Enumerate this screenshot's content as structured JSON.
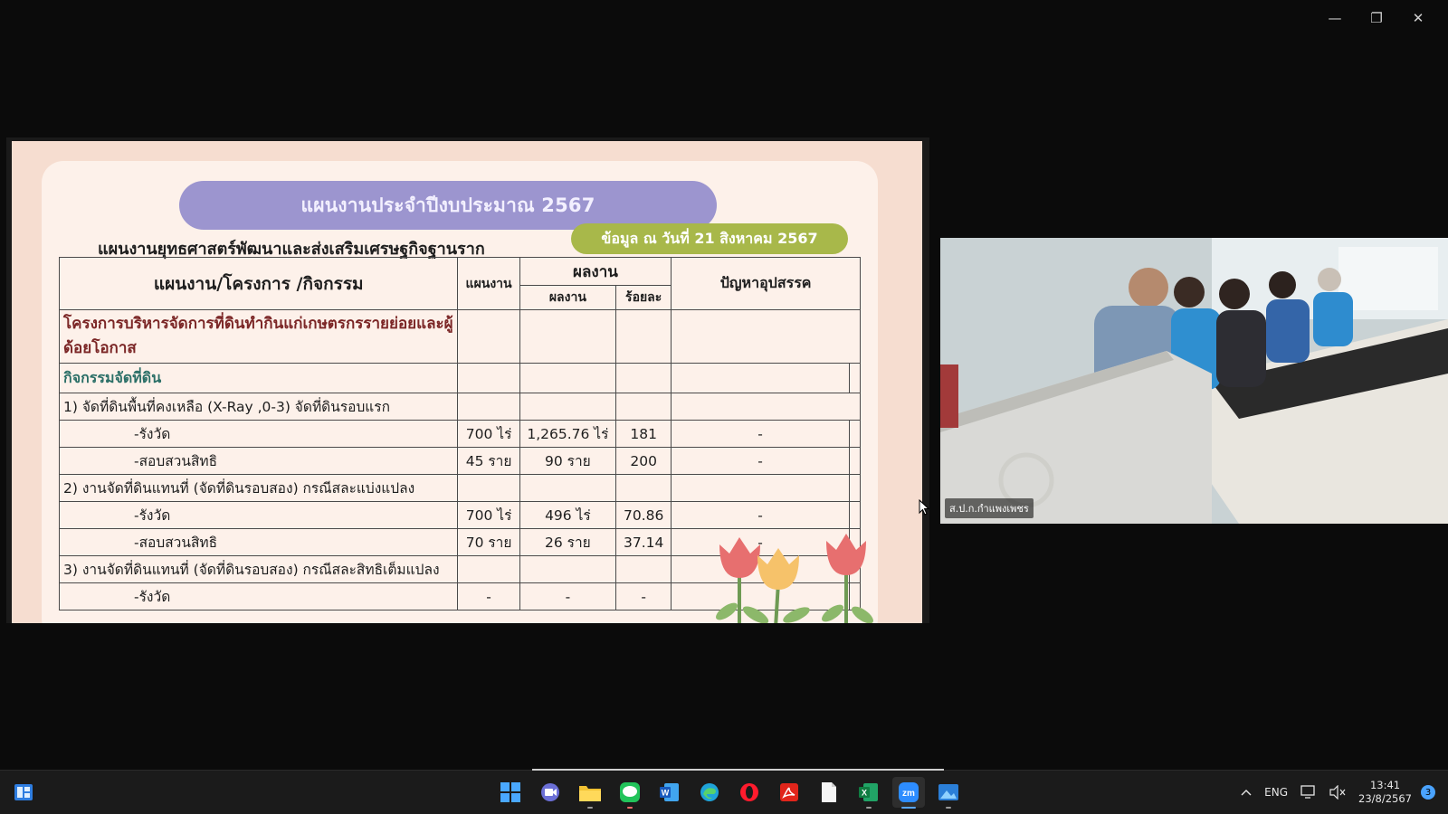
{
  "window": {
    "minimize": "—",
    "restore": "❐",
    "close": "✕"
  },
  "slide": {
    "title": "แผนงานประจำปีงบประมาณ 2567",
    "date_badge": "ข้อมูล ณ วันที่ 21 สิงหาคม 2567",
    "subtitle": "แผนงานยุทธศาสตร์พัฒนาและส่งเสริมเศรษฐกิจฐานราก",
    "table": {
      "headers": {
        "activity": "แผนงาน/โครงการ /กิจกรรม",
        "plan": "แผนงาน",
        "result_group": "ผลงาน",
        "result": "ผลงาน",
        "percent": "ร้อยละ",
        "issues": "ปัญหาอุปสรรค"
      },
      "project": "โครงการบริหารจัดการที่ดินทำกินแก่เกษตรกรรายย่อยและผู้ด้อยโอกาส",
      "activity": "กิจกรรมจัดที่ดิน",
      "rows": [
        {
          "label": "1) จัดที่ดินพื้นที่คงเหลือ (X-Ray ,0-3) จัดที่ดินรอบแรก",
          "plan": "",
          "result": "",
          "percent": "",
          "issues": "",
          "type": "item"
        },
        {
          "label": "-รังวัด",
          "plan": "700 ไร่",
          "result": "1,265.76 ไร่",
          "percent": "181",
          "issues": "-",
          "type": "sub"
        },
        {
          "label": "-สอบสวนสิทธิ",
          "plan": "45 ราย",
          "result": "90 ราย",
          "percent": "200",
          "issues": "-",
          "type": "sub"
        },
        {
          "label": "2) งานจัดที่ดินแทนที่ (จัดที่ดินรอบสอง) กรณีสละแบ่งแปลง",
          "plan": "",
          "result": "",
          "percent": "",
          "issues": "",
          "type": "item"
        },
        {
          "label": "-รังวัด",
          "plan": "700 ไร่",
          "result": "496 ไร่",
          "percent": "70.86",
          "issues": "-",
          "type": "sub"
        },
        {
          "label": "-สอบสวนสิทธิ",
          "plan": "70 ราย",
          "result": "26 ราย",
          "percent": "37.14",
          "issues": "-",
          "type": "sub"
        },
        {
          "label": "3) งานจัดที่ดินแทนที่ (จัดที่ดินรอบสอง) กรณีสละสิทธิเต็มแปลง",
          "plan": "",
          "result": "",
          "percent": "",
          "issues": "",
          "type": "item"
        },
        {
          "label": "-รังวัด",
          "plan": "-",
          "result": "-",
          "percent": "-",
          "issues": "",
          "type": "sub"
        }
      ]
    }
  },
  "video": {
    "participant_name": "ส.ป.ก.กำแพงเพชร"
  },
  "taskbar": {
    "apps": [
      "windows-start",
      "zoom-meetings",
      "file-explorer",
      "line",
      "word",
      "edge",
      "opera",
      "acrobat",
      "notepad",
      "excel",
      "zoom",
      "photos"
    ],
    "language": "ENG",
    "time": "13:41",
    "date": "23/8/2567",
    "notifications": "3"
  }
}
